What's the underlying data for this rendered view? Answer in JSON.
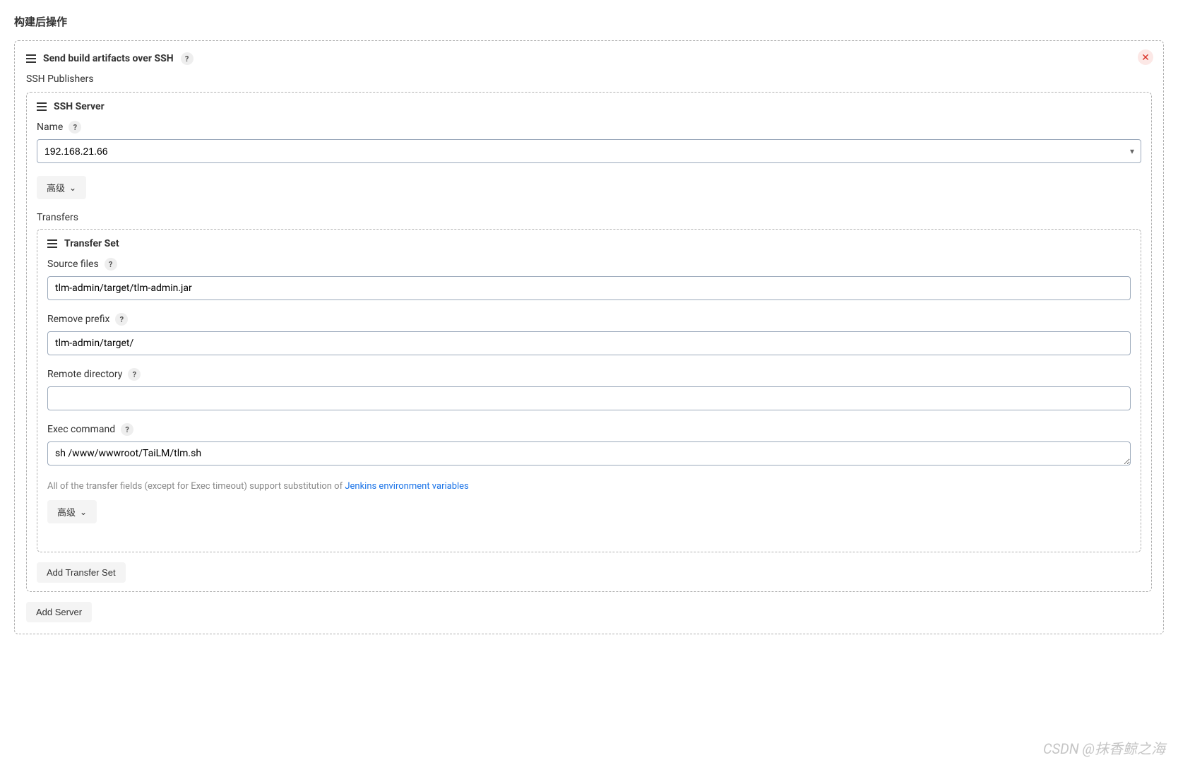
{
  "page": {
    "section_title": "构建后操作"
  },
  "build_step": {
    "title": "Send build artifacts over SSH",
    "publishers_label": "SSH Publishers"
  },
  "ssh_server": {
    "title": "SSH Server",
    "name_label": "Name",
    "name_value": "192.168.21.66",
    "advanced_label": "高级",
    "transfers_label": "Transfers"
  },
  "transfer_set": {
    "title": "Transfer Set",
    "source_files_label": "Source files",
    "source_files_value": "tlm-admin/target/tlm-admin.jar",
    "remove_prefix_label": "Remove prefix",
    "remove_prefix_value": "tlm-admin/target/",
    "remote_directory_label": "Remote directory",
    "remote_directory_value": "",
    "exec_command_label": "Exec command",
    "exec_command_value": "sh /www/wwwroot/TaiLM/tlm.sh",
    "info_text_prefix": "All of the transfer fields (except for Exec timeout) support substitution of ",
    "info_link_text": "Jenkins environment variables",
    "advanced_label": "高级"
  },
  "buttons": {
    "add_transfer_set": "Add Transfer Set",
    "add_server": "Add Server"
  },
  "watermark": "CSDN @抹香鲸之海"
}
